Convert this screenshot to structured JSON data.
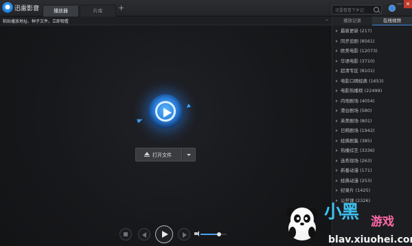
{
  "titlebar": {
    "app_title": "迅雷影音",
    "tabs": [
      "播放器",
      "片库"
    ],
    "add_tab": "+",
    "search_placeholder": "迅雷看看下乡记",
    "minimize": "—",
    "close": "×"
  },
  "address_bar": {
    "text": "粘贴播放地址、种子文件，立即观看",
    "chevron": "⌄"
  },
  "player": {
    "open_file_label": "打开文件",
    "volume_level": 0.7
  },
  "panel": {
    "tabs": [
      "播放记录",
      "在线视频"
    ],
    "active_tab": 1,
    "items": [
      "最新更新 (217)",
      "同步追剧 (8561)",
      "欧美电影 (12073)",
      "华语电影 (3710)",
      "超清专区 (8101)",
      "电影口碑经典 (1653)",
      "电影热播榜 (22499)",
      "内地剧场 (4054)",
      "港台剧场 (580)",
      "英美剧场 (801)",
      "日韩剧场 (1942)",
      "经典剧集 (385)",
      "热播综艺 (3336)",
      "选秀现场 (263)",
      "新番动漫 (171)",
      "经典动漫 (253)",
      "纪录片 (1425)",
      "公开课 (2326)"
    ]
  },
  "watermark": {
    "title": "小黑",
    "subtitle": "游戏",
    "url": "blav.xiuohei.com"
  },
  "colors": {
    "accent": "#3d8fe0",
    "background": "#16171a",
    "panel": "#1c1d20"
  }
}
